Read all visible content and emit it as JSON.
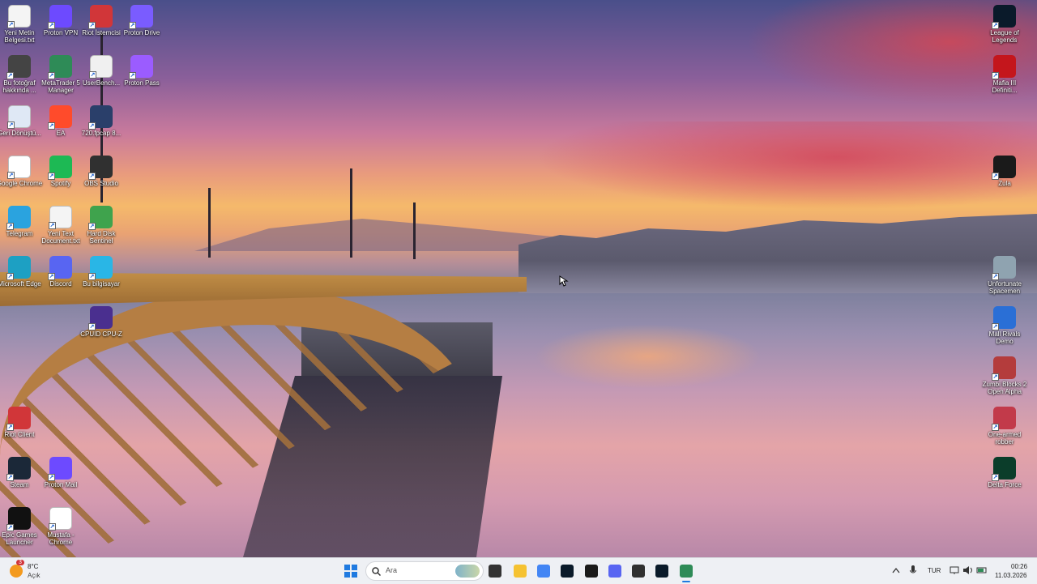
{
  "desktop_icons_left": [
    {
      "label": "Yeni Metin Belgesi.txt",
      "icon": "text-document-icon",
      "color": "#f4f4f4"
    },
    {
      "label": "Proton VPN",
      "icon": "proton-vpn-icon",
      "color": "#6d4aff"
    },
    {
      "label": "Riot İstemcisi",
      "icon": "riot-client-icon",
      "color": "#d13639"
    },
    {
      "label": "Proton Drive",
      "icon": "proton-drive-icon",
      "color": "#7a5cff"
    },
    {
      "label": "Bu fotoğraf hakkında ...",
      "icon": "camera-lens-icon",
      "color": "#444444"
    },
    {
      "label": "MetaTrader 5 Manager",
      "icon": "metatrader-icon",
      "color": "#2e8b57"
    },
    {
      "label": "UserBench...",
      "icon": "clock-icon",
      "color": "#f0f0f0"
    },
    {
      "label": "Proton Pass",
      "icon": "proton-pass-icon",
      "color": "#9b5cff"
    },
    {
      "label": "Geri Dönüştü...",
      "icon": "recycle-bin-icon",
      "color": "#dfe8f5"
    },
    {
      "label": "EA",
      "icon": "ea-icon",
      "color": "#ff4b2b"
    },
    {
      "label": "720.fpcap 8...",
      "icon": "video-file-icon",
      "color": "#2a3f6a"
    },
    {
      "label": "Google Chrome",
      "icon": "chrome-icon",
      "color": "#ffffff"
    },
    {
      "label": "Spotify",
      "icon": "spotify-icon",
      "color": "#1db954"
    },
    {
      "label": "OBS Studio",
      "icon": "obs-icon",
      "color": "#303030"
    },
    {
      "label": "Telegram",
      "icon": "telegram-icon",
      "color": "#2aa3df"
    },
    {
      "label": "Yeni Text Document.txt",
      "icon": "text-document-icon",
      "color": "#f4f4f4"
    },
    {
      "label": "Hard Disk Sentinel",
      "icon": "hard-disk-icon",
      "color": "#3fa34d"
    },
    {
      "label": "Microsoft Edge",
      "icon": "edge-icon",
      "color": "#1da0c3"
    },
    {
      "label": "Discord",
      "icon": "discord-icon",
      "color": "#5865f2"
    },
    {
      "label": "Bu bilgisayar",
      "icon": "monitor-icon",
      "color": "#29b6e6"
    },
    {
      "label": "CPUID CPU-Z",
      "icon": "cpu-z-icon",
      "color": "#4a2f8f"
    },
    {
      "label": "Riot Client",
      "icon": "riot-client-icon",
      "color": "#d13639"
    },
    {
      "label": "Steam",
      "icon": "steam-icon",
      "color": "#1b2838"
    },
    {
      "label": "Proton Mail",
      "icon": "proton-mail-icon",
      "color": "#6d4aff"
    },
    {
      "label": "Epic Games Launcher",
      "icon": "epic-games-icon",
      "color": "#111111"
    },
    {
      "label": "Mustafa - Chrome",
      "icon": "chrome-profile-icon",
      "color": "#ffffff"
    }
  ],
  "desktop_icons_right": [
    {
      "label": "League of Legends",
      "icon": "league-of-legends-icon",
      "color": "#0a1a2a"
    },
    {
      "label": "Mafia III Definiti...",
      "icon": "mafia-icon",
      "color": "#c4161c"
    },
    {
      "label": "Zula",
      "icon": "zula-icon",
      "color": "#1a1a1a"
    },
    {
      "label": "Unfortunate Spacemen",
      "icon": "spacemen-icon",
      "color": "#8fa3b0"
    },
    {
      "label": "Mall Rivals Demo",
      "icon": "mall-rivals-icon",
      "color": "#2a6fd6"
    },
    {
      "label": "Zumbi Blocks 2 Open Alpha",
      "icon": "zumbi-blocks-icon",
      "color": "#b43c3c"
    },
    {
      "label": "One-armed robber",
      "icon": "one-armed-robber-icon",
      "color": "#c23a4a"
    },
    {
      "label": "Delta Force",
      "icon": "delta-force-icon",
      "color": "#0b3d2a"
    }
  ],
  "taskbar": {
    "weather": {
      "temp": "8°C",
      "condition": "Açık",
      "badge": "3"
    },
    "search_placeholder": "Ara",
    "apps": [
      {
        "name": "start-button",
        "icon": "windows-icon",
        "color": "#1f7ae0"
      },
      {
        "name": "task-view-button",
        "icon": "task-view-icon",
        "color": "#333333"
      },
      {
        "name": "file-explorer-button",
        "icon": "folder-icon",
        "color": "#f5c231"
      },
      {
        "name": "chrome-profile-button",
        "icon": "chrome-profile-icon",
        "color": "#4285f4"
      },
      {
        "name": "league-button",
        "icon": "league-of-legends-icon",
        "color": "#0a1a2a"
      },
      {
        "name": "zula-button",
        "icon": "zula-icon",
        "color": "#1a1a1a"
      },
      {
        "name": "discord-button",
        "icon": "discord-icon",
        "color": "#5865f2"
      },
      {
        "name": "obs-button",
        "icon": "obs-icon",
        "color": "#303030"
      },
      {
        "name": "league-client-button",
        "icon": "league-of-legends-icon",
        "color": "#0a1a2a"
      },
      {
        "name": "mt5-button",
        "icon": "metatrader-icon",
        "color": "#2e8b57"
      }
    ],
    "tray": {
      "language": "TUR",
      "time": "00:26",
      "date": "11.03.2026"
    }
  }
}
